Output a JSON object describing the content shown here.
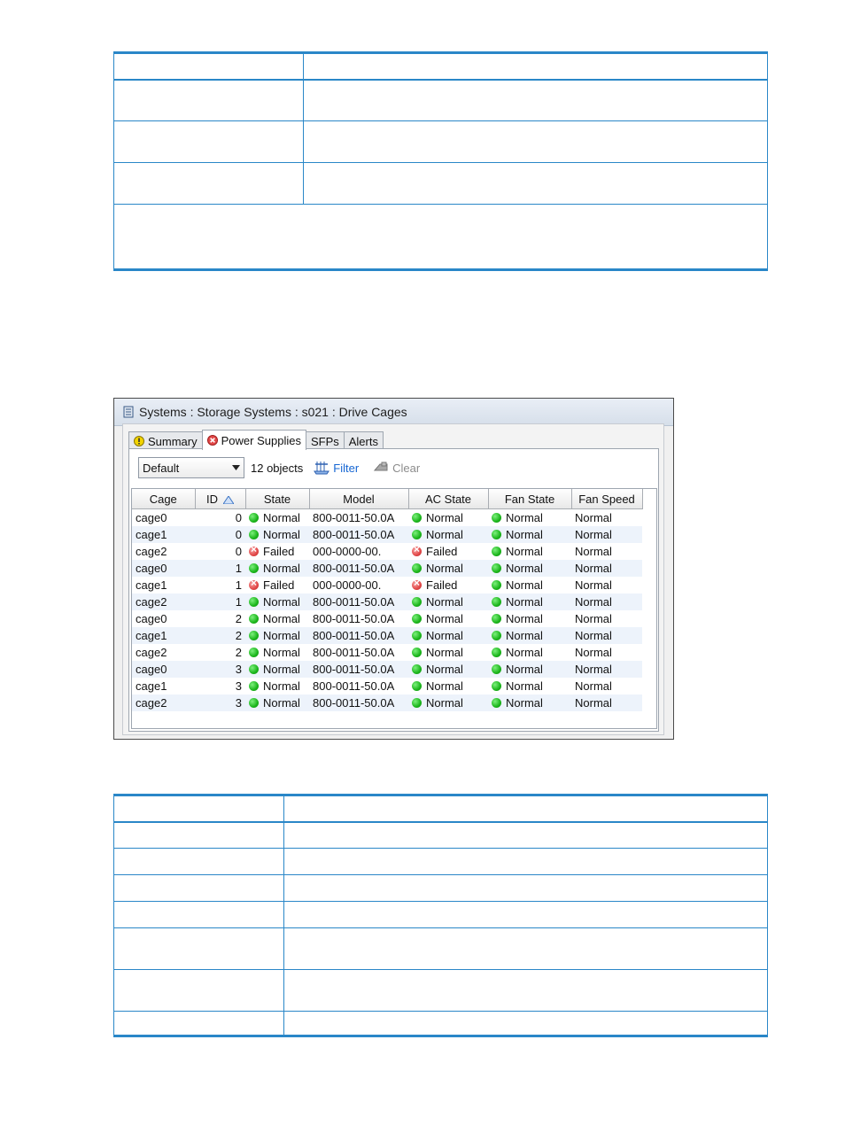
{
  "window": {
    "title": "Systems : Storage Systems : s021 : Drive Cages",
    "tabs": [
      {
        "label": "Summary",
        "icon": "warning-icon"
      },
      {
        "label": "Power Supplies",
        "icon": "error-icon"
      },
      {
        "label": "SFPs"
      },
      {
        "label": "Alerts"
      }
    ],
    "toolbar": {
      "view_select": "Default",
      "object_count": "12 objects",
      "filter_label": "Filter",
      "clear_label": "Clear"
    },
    "grid": {
      "columns": [
        "Cage",
        "ID",
        "State",
        "Model",
        "AC State",
        "Fan State",
        "Fan Speed"
      ],
      "sort_column": "ID",
      "rows": [
        {
          "cage": "cage0",
          "id": "0",
          "state": "Normal",
          "model": "800-0011-50.0A",
          "ac": "Normal",
          "fan": "Normal",
          "speed": "Normal"
        },
        {
          "cage": "cage1",
          "id": "0",
          "state": "Normal",
          "model": "800-0011-50.0A",
          "ac": "Normal",
          "fan": "Normal",
          "speed": "Normal"
        },
        {
          "cage": "cage2",
          "id": "0",
          "state": "Failed",
          "model": "000-0000-00.",
          "ac": "Failed",
          "fan": "Normal",
          "speed": "Normal"
        },
        {
          "cage": "cage0",
          "id": "1",
          "state": "Normal",
          "model": "800-0011-50.0A",
          "ac": "Normal",
          "fan": "Normal",
          "speed": "Normal"
        },
        {
          "cage": "cage1",
          "id": "1",
          "state": "Failed",
          "model": "000-0000-00.",
          "ac": "Failed",
          "fan": "Normal",
          "speed": "Normal"
        },
        {
          "cage": "cage2",
          "id": "1",
          "state": "Normal",
          "model": "800-0011-50.0A",
          "ac": "Normal",
          "fan": "Normal",
          "speed": "Normal"
        },
        {
          "cage": "cage0",
          "id": "2",
          "state": "Normal",
          "model": "800-0011-50.0A",
          "ac": "Normal",
          "fan": "Normal",
          "speed": "Normal"
        },
        {
          "cage": "cage1",
          "id": "2",
          "state": "Normal",
          "model": "800-0011-50.0A",
          "ac": "Normal",
          "fan": "Normal",
          "speed": "Normal"
        },
        {
          "cage": "cage2",
          "id": "2",
          "state": "Normal",
          "model": "800-0011-50.0A",
          "ac": "Normal",
          "fan": "Normal",
          "speed": "Normal"
        },
        {
          "cage": "cage0",
          "id": "3",
          "state": "Normal",
          "model": "800-0011-50.0A",
          "ac": "Normal",
          "fan": "Normal",
          "speed": "Normal"
        },
        {
          "cage": "cage1",
          "id": "3",
          "state": "Normal",
          "model": "800-0011-50.0A",
          "ac": "Normal",
          "fan": "Normal",
          "speed": "Normal"
        },
        {
          "cage": "cage2",
          "id": "3",
          "state": "Normal",
          "model": "800-0011-50.0A",
          "ac": "Normal",
          "fan": "Normal",
          "speed": "Normal"
        }
      ]
    }
  },
  "colors": {
    "table_rule": "#2a87c8",
    "status_ok": "#1bb51b",
    "status_failed": "#e24848",
    "link": "#1666d3",
    "row_alt": "#edf3fb"
  }
}
